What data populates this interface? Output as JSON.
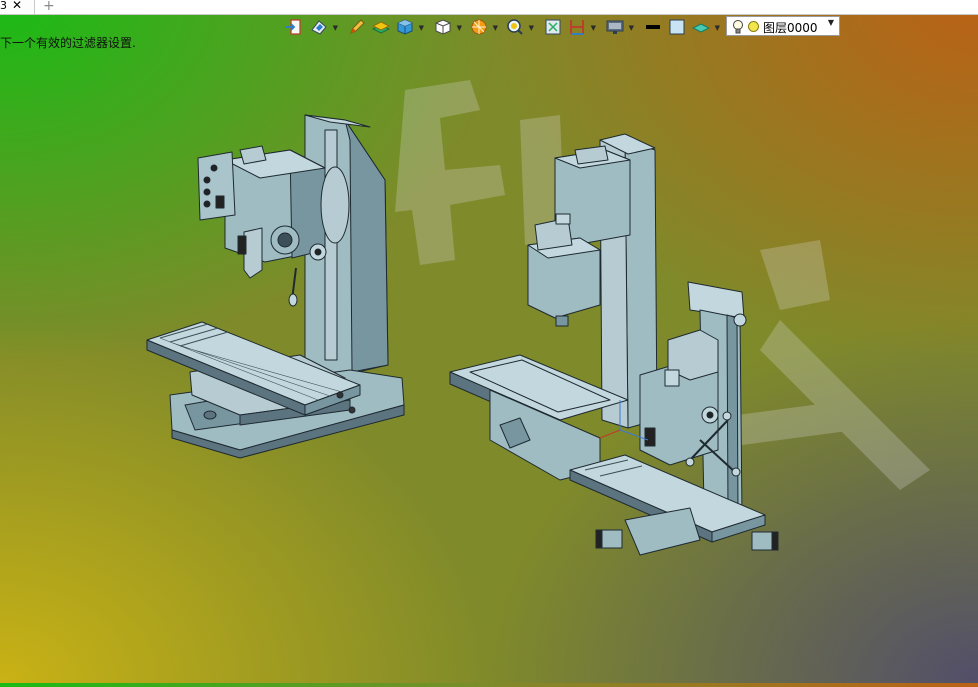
{
  "tabbar": {
    "tab_label": "3",
    "close_glyph": "✕",
    "add_glyph": "+"
  },
  "status": {
    "message": "下一个有效的过滤器设置."
  },
  "toolbar": {
    "buttons": [
      {
        "name": "insert-icon",
        "has_dropdown": false
      },
      {
        "name": "view-orient-icon",
        "has_dropdown": true
      },
      {
        "name": "pencil-icon",
        "has_dropdown": false
      },
      {
        "name": "layers-stack-icon",
        "has_dropdown": false
      },
      {
        "name": "cube-shaded-icon",
        "has_dropdown": true
      },
      {
        "name": "cube-white-icon",
        "has_dropdown": true
      },
      {
        "name": "render-style-icon",
        "has_dropdown": true
      },
      {
        "name": "zoom-icon",
        "has_dropdown": true
      },
      {
        "name": "fit-view-icon",
        "has_dropdown": false
      },
      {
        "name": "section-icon",
        "has_dropdown": true
      },
      {
        "name": "monitor-icon",
        "has_dropdown": true
      },
      {
        "name": "line-color-icon",
        "has_dropdown": false
      },
      {
        "name": "fill-color-icon",
        "has_dropdown": false
      },
      {
        "name": "plane-icon",
        "has_dropdown": true
      }
    ],
    "layer_combo": {
      "value": "图层0000"
    }
  },
  "colors": {
    "model_body": "#9fbcc3",
    "model_shadow": "#7896a0",
    "model_dark": "#5c7480",
    "outline": "#1e2a30"
  }
}
